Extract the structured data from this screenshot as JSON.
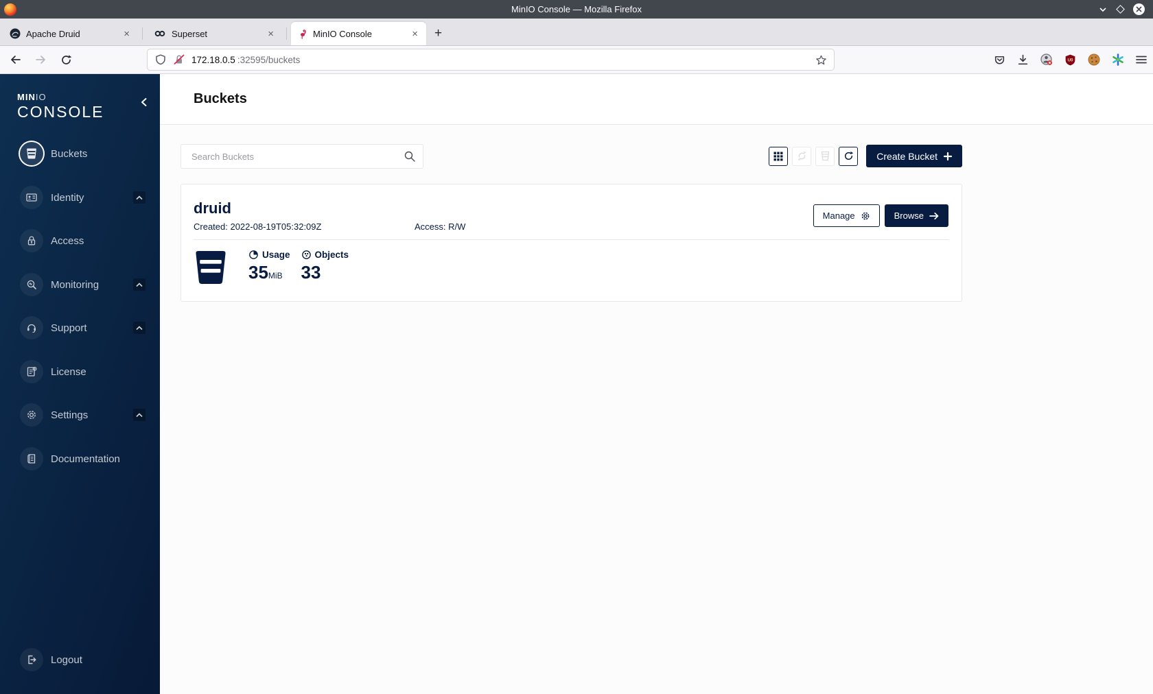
{
  "browser": {
    "window_title": "MinIO Console — Mozilla Firefox",
    "tabs": [
      {
        "label": "Apache Druid"
      },
      {
        "label": "Superset"
      },
      {
        "label": "MinIO Console"
      }
    ],
    "close_tab_glyph": "×",
    "new_tab_glyph": "+",
    "url": {
      "host": "172.18.0.5",
      "rest": ":32595/buckets"
    }
  },
  "sidebar": {
    "logo": {
      "min": "MIN",
      "io": "IO",
      "console": "CONSOLE"
    },
    "items": [
      {
        "label": "Buckets"
      },
      {
        "label": "Identity"
      },
      {
        "label": "Access"
      },
      {
        "label": "Monitoring"
      },
      {
        "label": "Support"
      },
      {
        "label": "License"
      },
      {
        "label": "Settings"
      },
      {
        "label": "Documentation"
      }
    ],
    "logout_label": "Logout"
  },
  "page": {
    "title": "Buckets",
    "search_placeholder": "Search Buckets",
    "create_bucket_label": "Create Bucket"
  },
  "bucket": {
    "name": "druid",
    "created": "Created: 2022-08-19T05:32:09Z",
    "access": "Access: R/W",
    "manage_label": "Manage",
    "browse_label": "Browse",
    "usage_label": "Usage",
    "usage_value": "35",
    "usage_unit": "MiB",
    "objects_label": "Objects",
    "objects_value": "33"
  },
  "colors": {
    "accent_navy": "#081C42",
    "sidebar_gradient_start": "#0e2f51",
    "sidebar_gradient_end": "#071a37",
    "titlebar_gray": "#42474e",
    "flamingo_red": "#c7254e",
    "insecure_red": "#e22850",
    "ublock_red": "#800610"
  }
}
